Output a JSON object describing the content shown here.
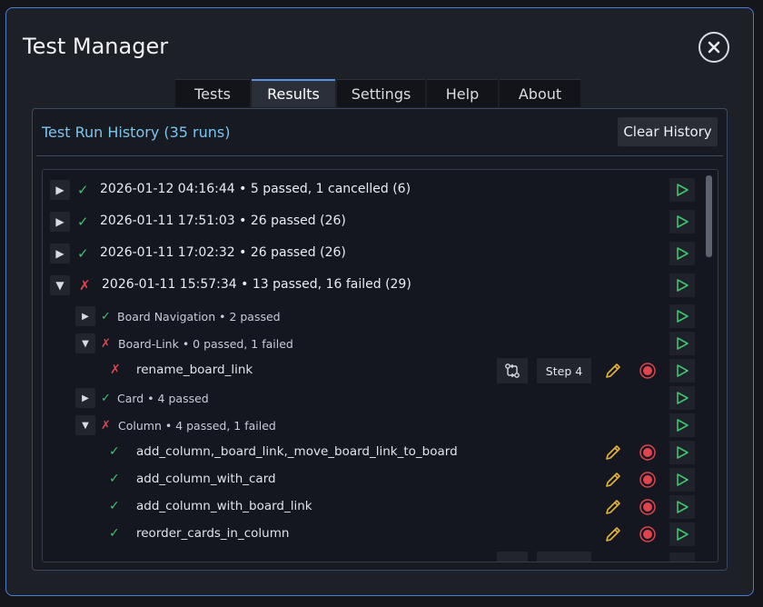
{
  "window": {
    "title": "Test Manager",
    "close_icon": "close-circle-icon"
  },
  "tabs": [
    {
      "label": "Tests",
      "active": false
    },
    {
      "label": "Results",
      "active": true
    },
    {
      "label": "Settings",
      "active": false
    },
    {
      "label": "Help",
      "active": false
    },
    {
      "label": "About",
      "active": false
    }
  ],
  "panel": {
    "title": "Test Run History (35 runs)",
    "clear_label": "Clear History"
  },
  "runs": [
    {
      "status": "✓",
      "text": "2026-01-12 04:16:44  •  5 passed, 1 cancelled (6)",
      "expanded": false
    },
    {
      "status": "✓",
      "text": "2026-01-11 17:51:03  •  26 passed (26)",
      "expanded": false
    },
    {
      "status": "✓",
      "text": "2026-01-11 17:02:32  •  26 passed (26)",
      "expanded": false
    },
    {
      "status": "✗",
      "text": "2026-01-11 15:57:34  •  13 passed, 16 failed (29)",
      "expanded": true
    }
  ],
  "groups": [
    {
      "status": "✓",
      "text": "Board Navigation  •  2 passed",
      "expanded": false
    },
    {
      "status": "✗",
      "text": "Board-Link  •  0 passed, 1 failed",
      "expanded": true
    },
    {
      "status": "✓",
      "text": "Card  •  4 passed",
      "expanded": false
    },
    {
      "status": "✗",
      "text": "Column  •  4 passed, 1 failed",
      "expanded": true
    }
  ],
  "tests": [
    {
      "status": "✗",
      "name": "rename_board_link",
      "step_label": "Step 4"
    },
    {
      "status": "✓",
      "name": "add_column,_board_link,_move_board_link_to_board"
    },
    {
      "status": "✓",
      "name": "add_column_with_card"
    },
    {
      "status": "✓",
      "name": "add_column_with_board_link"
    },
    {
      "status": "✓",
      "name": "reorder_cards_in_column"
    }
  ],
  "icons": {
    "expand": "▶",
    "collapse": "▼",
    "play": "play-icon",
    "edit": "pencil-icon",
    "record": "record-icon",
    "compare": "compare-icon"
  },
  "colors": {
    "accent": "#7cc4f0",
    "pass": "#3ec46d",
    "fail": "#e0444c",
    "edit": "#e3b23c"
  }
}
